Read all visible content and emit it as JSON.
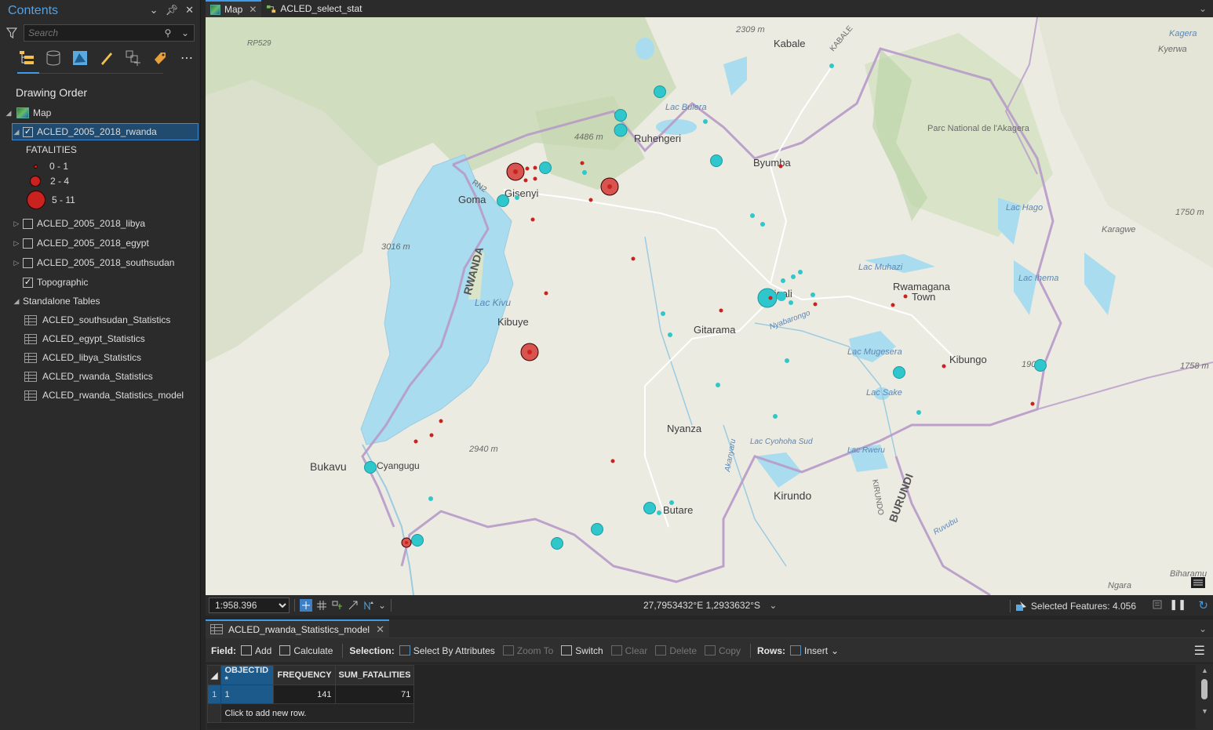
{
  "contents": {
    "title": "Contents",
    "search_placeholder": "Search",
    "drawing_order": "Drawing Order",
    "map_label": "Map",
    "layer_rwanda": "ACLED_2005_2018_rwanda",
    "legend_title": "FATALITIES",
    "legend": [
      {
        "label": "0 - 1"
      },
      {
        "label": "2 - 4"
      },
      {
        "label": "5 - 11"
      }
    ],
    "layer_libya": "ACLED_2005_2018_libya",
    "layer_egypt": "ACLED_2005_2018_egypt",
    "layer_southsudan": "ACLED_2005_2018_southsudan",
    "layer_topo": "Topographic",
    "standalone_tables": "Standalone Tables",
    "tables": [
      "ACLED_southsudan_Statistics",
      "ACLED_egypt_Statistics",
      "ACLED_libya_Statistics",
      "ACLED_rwanda_Statistics",
      "ACLED_rwanda_Statistics_model"
    ]
  },
  "map": {
    "tab_map": "Map",
    "tab_model": "ACLED_select_stat",
    "scale": "1:958.396",
    "coords": "27,7953432°E 1,2933632°S",
    "selected_features": "Selected Features: 4.056",
    "labels": {
      "kabale": "Kabale",
      "ruhengeri": "Ruhengeri",
      "byumba": "Byumba",
      "gisenyi": "Gisenyi",
      "goma": "Goma",
      "kigali": "Kigali",
      "rwamagana": "Rwamagana",
      "town": "Town",
      "gitarama": "Gitarama",
      "kibuye": "Kibuye",
      "kibungo": "Kibungo",
      "nyanza": "Nyanza",
      "bukavu": "Bukavu",
      "cyangugu": "Cyangugu",
      "butare": "Butare",
      "kirundo": "Kirundo",
      "rwanda": "RWANDA",
      "burundi": "BURUNDI",
      "lac_kivu": "Lac Kivu",
      "lac_bulera": "Lac Bulera",
      "lac_muhazi": "Lac Muhazi",
      "lac_mugesera": "Lac Mugesera",
      "lac_sake": "Lac Sake",
      "lac_hago": "Lac Hago",
      "lac_ihema": "Lac Ihema",
      "lac_cyohoha": "Lac Cyohoha Sud",
      "lac_rweru": "Lac Rweru",
      "parc": "Parc National de l'Akagera",
      "karagwe": "Karagwe",
      "kyerwa": "Kyerwa",
      "kagera": "Kagera",
      "ngara": "Ngara",
      "biharamulo": "Biharamu",
      "elev_2309": "2309 m",
      "elev_4486": "4486 m",
      "elev_3016": "3016 m",
      "elev_2940": "2940 m",
      "elev_1750": "1750 m",
      "elev_1758": "1758 m",
      "elev_1902": "1902",
      "rp529": "RP529",
      "rn2": "RN2",
      "kabale_road": "KABALE",
      "nyabarongo": "Nyabarongo",
      "kirundo_road": "KIRUNDO",
      "akanyaru": "Akanyaru",
      "ruvubu": "Ruvubu"
    }
  },
  "table": {
    "tab_label": "ACLED_rwanda_Statistics_model",
    "field_label": "Field:",
    "add": "Add",
    "calculate": "Calculate",
    "selection_label": "Selection:",
    "select_by_attributes": "Select By Attributes",
    "zoom_to": "Zoom To",
    "switch": "Switch",
    "clear": "Clear",
    "delete": "Delete",
    "copy": "Copy",
    "rows_label": "Rows:",
    "insert": "Insert",
    "columns": [
      "OBJECTID *",
      "FREQUENCY",
      "SUM_FATALITIES"
    ],
    "rows": [
      {
        "num": "1",
        "objectid": "1",
        "frequency": "141",
        "sum_fatalities": "71"
      }
    ],
    "add_row": "Click to add new row."
  },
  "colors": {
    "accent": "#3d9be9",
    "point_fill": "#c9221f",
    "selected_point": "#2fc6cc",
    "water": "#a9dcef",
    "border": "#b79ac8"
  }
}
